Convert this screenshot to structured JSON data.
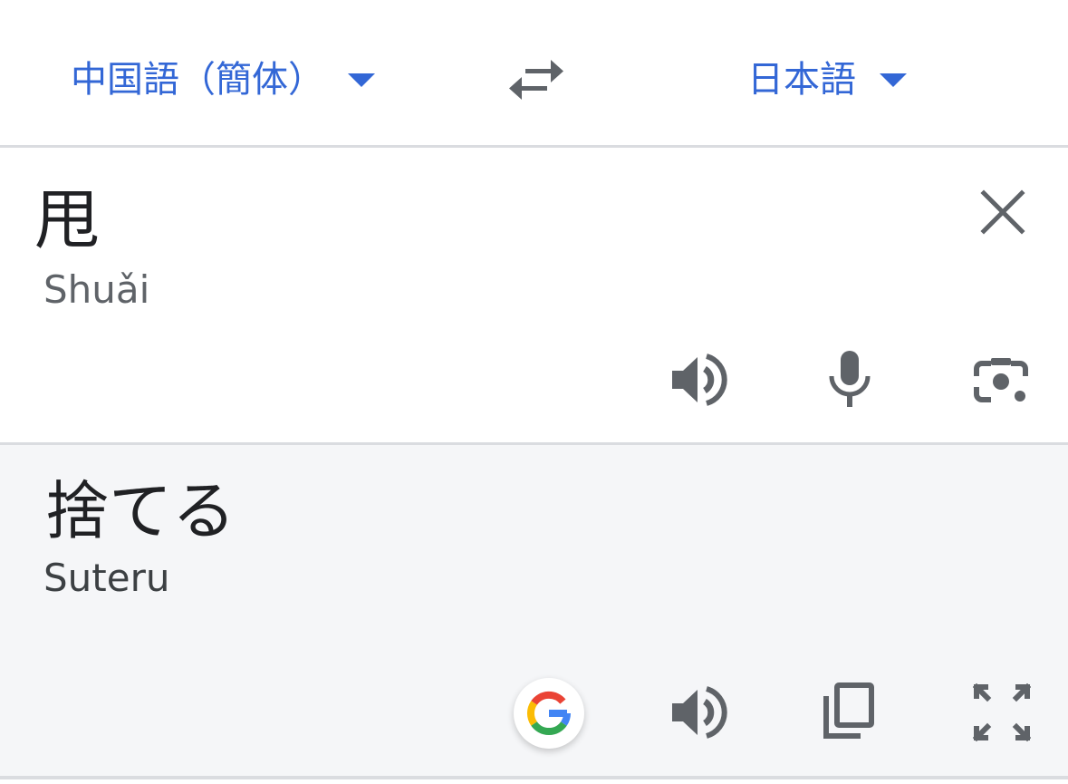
{
  "languages": {
    "source_label": "中国語（簡体）",
    "target_label": "日本語"
  },
  "source": {
    "text": "甩",
    "romanization": "Shuǎi"
  },
  "translation": {
    "text": "捨てる",
    "romanization": "Suteru"
  },
  "icons": {
    "source_caret": "caret-down-icon",
    "swap": "swap-arrows-icon",
    "target_caret": "caret-down-icon",
    "clear": "close-icon",
    "source_speak": "speaker-icon",
    "mic": "microphone-icon",
    "camera": "camera-lens-icon",
    "google": "google-g-icon",
    "target_speak": "speaker-icon",
    "copy": "copy-icon",
    "fullscreen": "fullscreen-icon"
  },
  "colors": {
    "accent": "#3367d6",
    "icon": "#5f6368",
    "text": "#202124",
    "translation_bg": "#f5f6f8",
    "divider": "#dadce0"
  }
}
